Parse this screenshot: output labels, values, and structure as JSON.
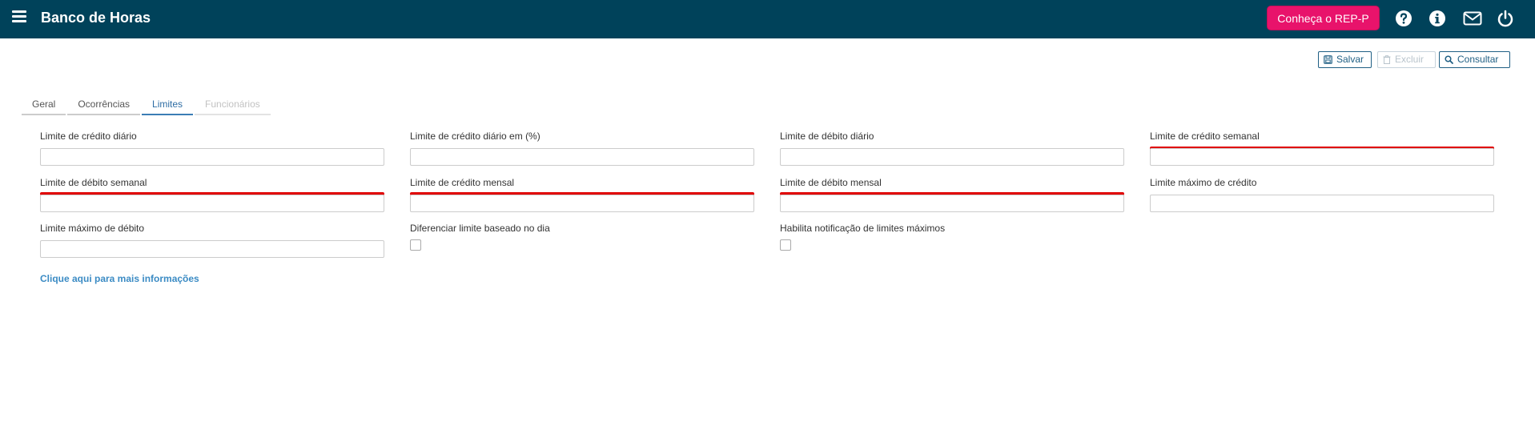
{
  "header": {
    "title": "Banco de Horas",
    "rep_button_label": "Conheça o REP-P",
    "icons": [
      "menu-icon",
      "help-icon",
      "info-icon",
      "mail-icon",
      "power-icon"
    ]
  },
  "toolbar": {
    "save_label": "Salvar",
    "delete_label": "Excluir",
    "query_label": "Consultar"
  },
  "tabs": [
    {
      "label": "Geral",
      "state": "normal"
    },
    {
      "label": "Ocorrências",
      "state": "normal"
    },
    {
      "label": "Limites",
      "state": "active"
    },
    {
      "label": "Funcionários",
      "state": "disabled"
    }
  ],
  "form": {
    "fields": [
      {
        "label": "Limite de crédito diário",
        "value": ""
      },
      {
        "label": "Limite de crédito diário em (%)",
        "value": ""
      },
      {
        "label": "Limite de débito diário",
        "value": ""
      },
      {
        "label": "Limite de crédito semanal",
        "value": ""
      },
      {
        "label": "Limite de débito semanal",
        "value": ""
      },
      {
        "label": "Limite de crédito mensal",
        "value": ""
      },
      {
        "label": "Limite de débito mensal",
        "value": ""
      },
      {
        "label": "Limite máximo de crédito",
        "value": ""
      },
      {
        "label": "Limite máximo de débito",
        "value": ""
      }
    ],
    "checkboxes": [
      {
        "label": "Diferenciar limite baseado no dia",
        "checked": false
      },
      {
        "label": "Habilita notificação de limites máximos",
        "checked": false
      }
    ],
    "info_link": "Clique aqui para mais informações"
  },
  "colors": {
    "header_bg": "#00425a",
    "rep_button": "#e8136b",
    "accent": "#3b7db5",
    "annotation_red": "#e00000"
  }
}
